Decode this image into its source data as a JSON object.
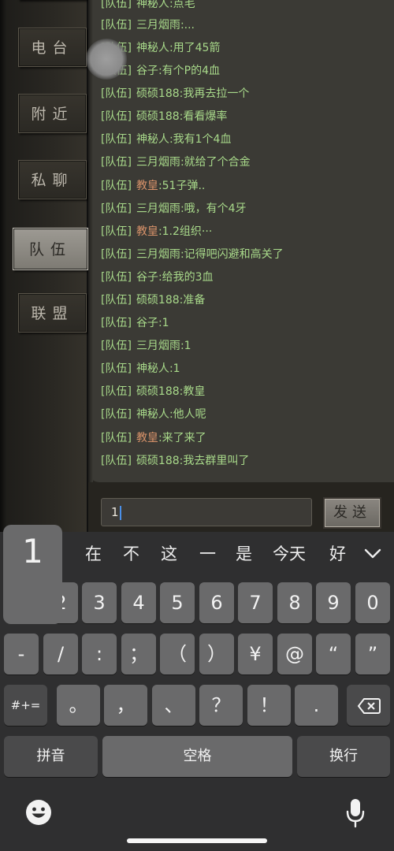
{
  "sidebar": {
    "tabs": [
      {
        "label": "电台",
        "active": false
      },
      {
        "label": "附近",
        "active": false
      },
      {
        "label": "私聊",
        "active": false
      },
      {
        "label": "队伍",
        "active": true
      },
      {
        "label": "联盟",
        "active": false
      }
    ]
  },
  "chat": {
    "channel_tag": "[队伍]",
    "messages": [
      {
        "name": "神秘人",
        "text": ":点毛",
        "highlight": false
      },
      {
        "name": "三月烟雨",
        "text": ":...",
        "highlight": false
      },
      {
        "name": "神秘人",
        "text": ":用了45箭",
        "highlight": false
      },
      {
        "name": "谷子",
        "text": ":有个P的4血",
        "highlight": false
      },
      {
        "name": "硕硕188",
        "text": ":我再去拉一个",
        "highlight": false
      },
      {
        "name": "硕硕188",
        "text": ":看看爆率",
        "highlight": false
      },
      {
        "name": "神秘人",
        "text": ":我有1个4血",
        "highlight": false
      },
      {
        "name": "三月烟雨",
        "text": ":就给了个合金",
        "highlight": false
      },
      {
        "name": "教皇",
        "text": ":51子弹..",
        "highlight": true
      },
      {
        "name": "三月烟雨",
        "text": ":哦，有个4牙",
        "highlight": false
      },
      {
        "name": "教皇",
        "text": ":1.2组织···",
        "highlight": true
      },
      {
        "name": "三月烟雨",
        "text": ":记得吧闪避和高关了",
        "highlight": false
      },
      {
        "name": "谷子",
        "text": ":给我的3血",
        "highlight": false
      },
      {
        "name": "硕硕188",
        "text": ":准备",
        "highlight": false
      },
      {
        "name": "谷子",
        "text": ":1",
        "highlight": false
      },
      {
        "name": "三月烟雨",
        "text": ":1",
        "highlight": false
      },
      {
        "name": "神秘人",
        "text": ":1",
        "highlight": false
      },
      {
        "name": "硕硕188",
        "text": ":教皇",
        "highlight": false
      },
      {
        "name": "神秘人",
        "text": ":他人呢",
        "highlight": false
      },
      {
        "name": "教皇",
        "text": ":来了来了",
        "highlight": true
      },
      {
        "name": "硕硕188",
        "text": ":我去群里叫了",
        "highlight": false
      }
    ]
  },
  "input": {
    "value": "1",
    "send_label": "发送"
  },
  "keyboard": {
    "popup_char": "1",
    "candidates": [
      "不",
      "在",
      "不",
      "这",
      "一",
      "是",
      "今天",
      "好"
    ],
    "row_numbers": [
      "1",
      "2",
      "3",
      "4",
      "5",
      "6",
      "7",
      "8",
      "9",
      "0"
    ],
    "row_symbols": [
      "-",
      "/",
      ":",
      "；",
      "（",
      "）",
      "¥",
      "@",
      "“",
      "”"
    ],
    "row_punct_mode": "#+=",
    "row_punct": [
      "。",
      "，",
      "、",
      "？",
      "！",
      "."
    ],
    "pinyin_label": "拼音",
    "space_label": "空格",
    "return_label": "换行"
  },
  "colors": {
    "name_highlight": "#d9936a",
    "message_text": "#a8d98a",
    "caret": "#4a8fe8"
  }
}
